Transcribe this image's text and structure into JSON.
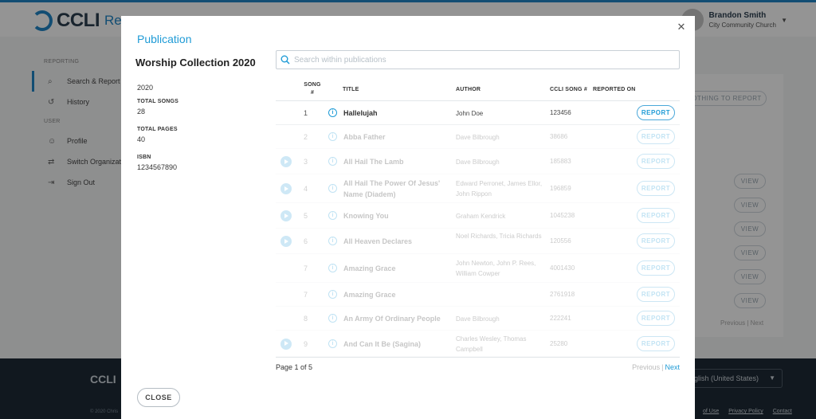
{
  "app": {
    "logo_text": "CCLI",
    "logo_sub": "Rep",
    "user_name": "Brandon Smith",
    "user_church": "City Community Church"
  },
  "sidebar": {
    "reporting_heading": "REPORTING",
    "user_heading": "USER",
    "items": [
      {
        "label": "Search & Report",
        "icon": "search-icon"
      },
      {
        "label": "History",
        "icon": "history-icon"
      },
      {
        "label": "Profile",
        "icon": "user-icon"
      },
      {
        "label": "Switch Organizat",
        "icon": "switch-icon"
      },
      {
        "label": "Sign Out",
        "icon": "sign-out-icon"
      }
    ]
  },
  "background": {
    "nothing_to_report": "OTHING TO REPORT",
    "view_label": "VIEW",
    "pager_prev": "Previous",
    "pager_next": "Next"
  },
  "footer": {
    "logo": "CCLI",
    "language": "glish (United States)",
    "copyright": "© 2020 Chris",
    "links": [
      "of Use",
      "Privacy Policy",
      "Contact"
    ]
  },
  "modal": {
    "title": "Publication",
    "publication_name": "Worship Collection 2020",
    "year": "2020",
    "total_songs_label": "TOTAL SONGS",
    "total_songs": "28",
    "total_pages_label": "TOTAL PAGES",
    "total_pages": "40",
    "isbn_label": "ISBN",
    "isbn": "1234567890",
    "search_placeholder": "Search within publications",
    "columns": {
      "song_num": "SONG #",
      "title": "TITLE",
      "author": "AUTHOR",
      "ccli": "CCLI SONG #",
      "reported_on": "REPORTED ON"
    },
    "report_label": "REPORT",
    "rows": [
      {
        "num": "1",
        "title": "Hallelujah",
        "author": "John Doe",
        "ccli": "123456",
        "play": false,
        "dim": false
      },
      {
        "num": "2",
        "title": "Abba Father",
        "author": "Dave Bilbrough",
        "ccli": "38686",
        "play": false,
        "dim": true
      },
      {
        "num": "3",
        "title": "All Hail The Lamb",
        "author": "Dave Bilbrough",
        "ccli": "185883",
        "play": true,
        "dim": true
      },
      {
        "num": "4",
        "title": "All Hail The Power Of Jesus' Name (Diadem)",
        "author": "Edward Perronet, James Ellor, John Rippon",
        "ccli": "196859",
        "play": true,
        "dim": true
      },
      {
        "num": "5",
        "title": "Knowing You",
        "author": "Graham Kendrick",
        "ccli": "1045238",
        "play": true,
        "dim": true
      },
      {
        "num": "6",
        "title": "All Heaven Declares",
        "author": "Noel Richards, Tricia Richards",
        "ccli": "120556",
        "play": true,
        "dim": true
      },
      {
        "num": "7",
        "title": "Amazing Grace",
        "author": "John Newton, John P. Rees, William Cowper",
        "ccli": "4001430",
        "play": false,
        "dim": true
      },
      {
        "num": "7",
        "title": "Amazing Grace",
        "author": "",
        "ccli": "2761918",
        "play": false,
        "dim": true
      },
      {
        "num": "8",
        "title": "An Army Of Ordinary People",
        "author": "Dave Bilbrough",
        "ccli": "222241",
        "play": false,
        "dim": true
      },
      {
        "num": "9",
        "title": "And Can It Be (Sagina)",
        "author": "Charles Wesley, Thomas Campbell",
        "ccli": "25280",
        "play": true,
        "dim": true
      }
    ],
    "page_info": "Page 1 of 5",
    "pager_prev": "Previous",
    "pager_sep": "|",
    "pager_next": "Next",
    "close_label": "CLOSE"
  }
}
